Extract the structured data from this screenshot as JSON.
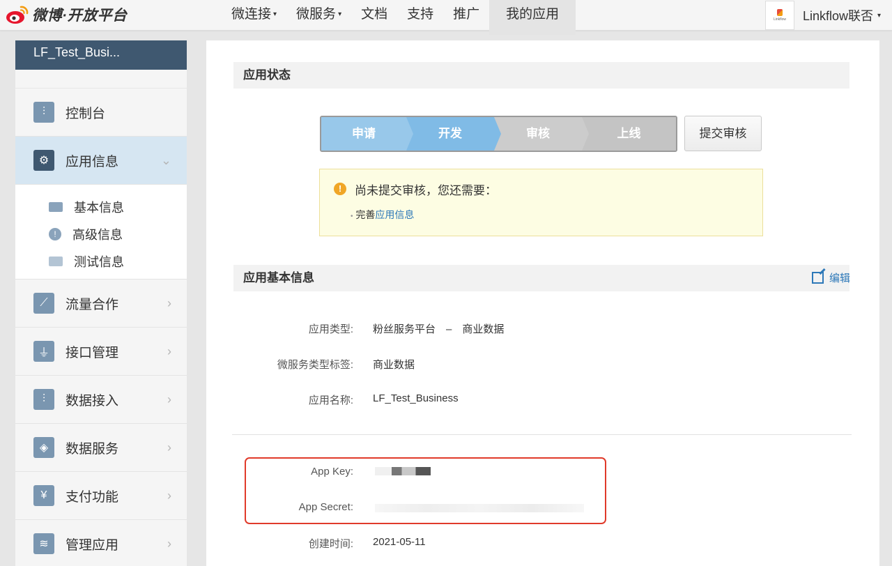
{
  "header": {
    "logo_text": "微博·开放平台",
    "nav": [
      {
        "label": "微连接",
        "caret": "▾"
      },
      {
        "label": "微服务",
        "caret": "▾"
      },
      {
        "label": "文档",
        "caret": ""
      },
      {
        "label": "支持",
        "caret": ""
      },
      {
        "label": "推广",
        "caret": ""
      },
      {
        "label": "我的应用",
        "caret": ""
      }
    ],
    "user": {
      "name": "Linkflow联否",
      "avatar_text": "Linkflow",
      "caret": "▾"
    }
  },
  "sidebar": {
    "app_name": "LF_Test_Busi...",
    "items": [
      {
        "label": "控制台",
        "icon": "sliders-icon"
      },
      {
        "label": "应用信息",
        "icon": "gear-icon",
        "active": true
      },
      {
        "label": "流量合作",
        "icon": "chart-icon"
      },
      {
        "label": "接口管理",
        "icon": "plug-icon"
      },
      {
        "label": "数据接入",
        "icon": "sliders-icon"
      },
      {
        "label": "数据服务",
        "icon": "tag-icon"
      },
      {
        "label": "支付功能",
        "icon": "yen-icon"
      },
      {
        "label": "管理应用",
        "icon": "layers-icon"
      }
    ],
    "sub_items": [
      {
        "label": "基本信息",
        "icon": "id-card-icon"
      },
      {
        "label": "高级信息",
        "icon": "info-icon"
      },
      {
        "label": "测试信息",
        "icon": "test-card-icon"
      }
    ]
  },
  "main": {
    "status_title": "应用状态",
    "steps": [
      "申请",
      "开发",
      "审核",
      "上线"
    ],
    "submit_label": "提交审核",
    "notice": {
      "title": "尚未提交审核，您还需要：",
      "bullet": "•",
      "item_prefix": "完善",
      "item_link": "应用信息"
    },
    "basic_title": "应用基本信息",
    "edit_label": "编辑",
    "fields": [
      {
        "key": "应用类型:",
        "value": "粉丝服务平台　–　商业数据"
      },
      {
        "key": "微服务类型标签:",
        "value": "商业数据"
      },
      {
        "key": "应用名称:",
        "value": "LF_Test_Business"
      }
    ],
    "secret_fields": [
      {
        "key": "App Key:"
      },
      {
        "key": "App Secret:"
      }
    ],
    "created": {
      "key": "创建时间:",
      "value": "2021-05-11"
    }
  },
  "colors": {
    "sidebar_header": "#3f5870",
    "active_item": "#d6e6f2",
    "step_done": "#98c8ea",
    "step_current": "#80bbe6",
    "step_pending": "#cccccc",
    "link": "#2d78b8",
    "highlight": "#e03a2a"
  }
}
